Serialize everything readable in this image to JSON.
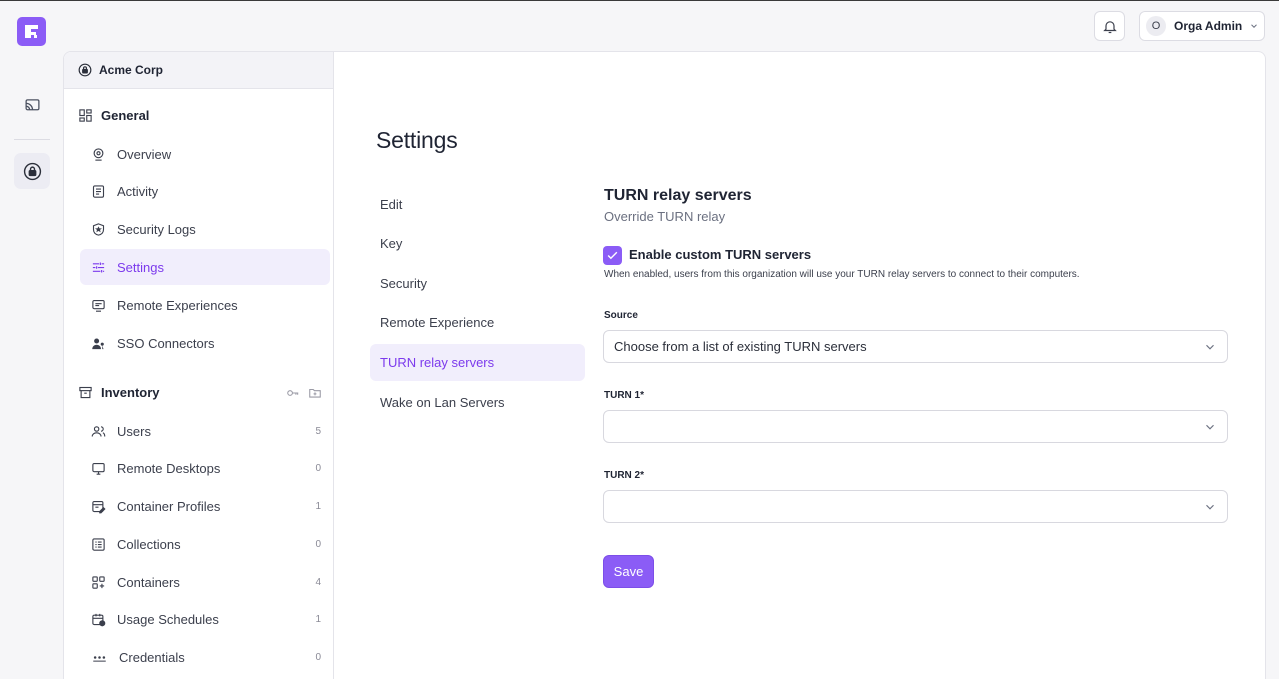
{
  "header": {
    "user_initial": "O",
    "user_name": "Orga Admin"
  },
  "rail": {
    "items": [
      {
        "icon": "cast-icon"
      },
      {
        "icon": "lock-icon",
        "active": true
      }
    ]
  },
  "sidebar": {
    "org_name": "Acme Corp",
    "general": {
      "title": "General",
      "items": [
        {
          "label": "Overview",
          "icon": "overview-icon"
        },
        {
          "label": "Activity",
          "icon": "activity-icon"
        },
        {
          "label": "Security Logs",
          "icon": "shield-icon"
        },
        {
          "label": "Settings",
          "icon": "sliders-icon",
          "active": true
        },
        {
          "label": "Remote Experiences",
          "icon": "monitor-icon"
        },
        {
          "label": "SSO Connectors",
          "icon": "user-key-icon"
        }
      ]
    },
    "inventory": {
      "title": "Inventory",
      "items": [
        {
          "label": "Users",
          "count": "5",
          "icon": "users-icon"
        },
        {
          "label": "Remote Desktops",
          "count": "0",
          "icon": "desktop-icon"
        },
        {
          "label": "Container Profiles",
          "count": "1",
          "icon": "profile-icon"
        },
        {
          "label": "Collections",
          "count": "0",
          "icon": "collections-icon"
        },
        {
          "label": "Containers",
          "count": "4",
          "icon": "containers-icon"
        },
        {
          "label": "Usage Schedules",
          "count": "1",
          "icon": "calendar-icon"
        },
        {
          "label": "Credentials",
          "count": "0",
          "icon": "password-icon"
        }
      ]
    }
  },
  "main": {
    "title": "Settings",
    "sub_nav": [
      {
        "label": "Edit"
      },
      {
        "label": "Key"
      },
      {
        "label": "Security"
      },
      {
        "label": "Remote Experience"
      },
      {
        "label": "TURN relay servers",
        "active": true
      },
      {
        "label": "Wake on Lan Servers"
      }
    ],
    "panel": {
      "title": "TURN relay servers",
      "subtitle": "Override TURN relay",
      "checkbox_label": "Enable custom TURN servers",
      "checkbox_checked": true,
      "checkbox_help": "When enabled, users from this organization will use your TURN relay servers to connect to their computers.",
      "source_label": "Source",
      "source_value": "Choose from a list of existing TURN servers",
      "turn1_label": "TURN 1*",
      "turn1_value": "",
      "turn2_label": "TURN 2*",
      "turn2_value": "",
      "save_label": "Save"
    }
  },
  "colors": {
    "accent": "#8b5cf6",
    "active_bg": "#f1eefc",
    "active_text": "#7c3aed"
  }
}
